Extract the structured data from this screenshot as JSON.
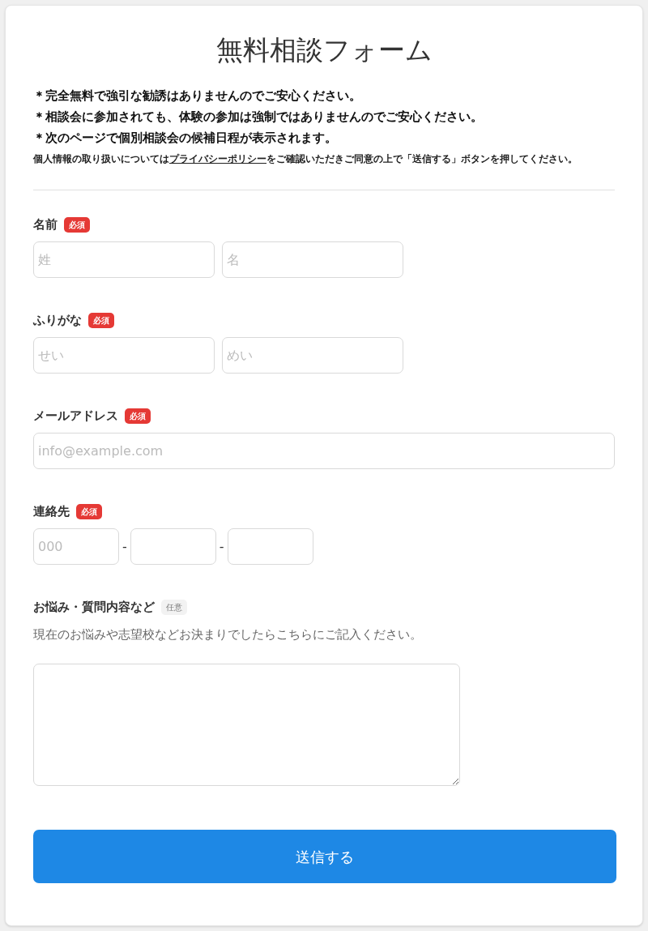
{
  "title": "無料相談フォーム",
  "notes": [
    "＊完全無料で強引な勧誘はありませんのでご安心ください。",
    "＊相談会に参加されても、体験の参加は強制ではありませんのでご安心ください。",
    "＊次のページで個別相談会の候補日程が表示されます。"
  ],
  "privacy": {
    "before": "個人情報の取り扱いについては",
    "link": "プライバシーポリシー",
    "after": "をご確認いただきご同意の上で「送信する」ボタンを押してください。"
  },
  "fields": [
    {
      "label": "名前",
      "badge": {
        "text": "必須",
        "kind": "required"
      },
      "kind": "pair",
      "inputs": [
        {
          "placeholder": "姓"
        },
        {
          "placeholder": "名"
        }
      ]
    },
    {
      "label": "ふりがな",
      "badge": {
        "text": "必須",
        "kind": "required"
      },
      "kind": "pair",
      "inputs": [
        {
          "placeholder": "せい"
        },
        {
          "placeholder": "めい"
        }
      ]
    },
    {
      "label": "メールアドレス",
      "badge": {
        "text": "必須",
        "kind": "required"
      },
      "kind": "wide",
      "inputs": [
        {
          "placeholder": "info@example.com"
        }
      ]
    },
    {
      "label": "連絡先",
      "badge": {
        "text": "必須",
        "kind": "required"
      },
      "kind": "phone",
      "inputs": [
        {
          "placeholder": "000"
        }
      ],
      "separators": [
        "-",
        "-"
      ]
    },
    {
      "label": "お悩み・質問内容など",
      "badge": {
        "text": "任意",
        "kind": "optional"
      },
      "kind": "textarea",
      "description": "現在のお悩みや志望校などお決まりでしたらこちらにご記入ください。"
    }
  ],
  "submit": "送信する"
}
